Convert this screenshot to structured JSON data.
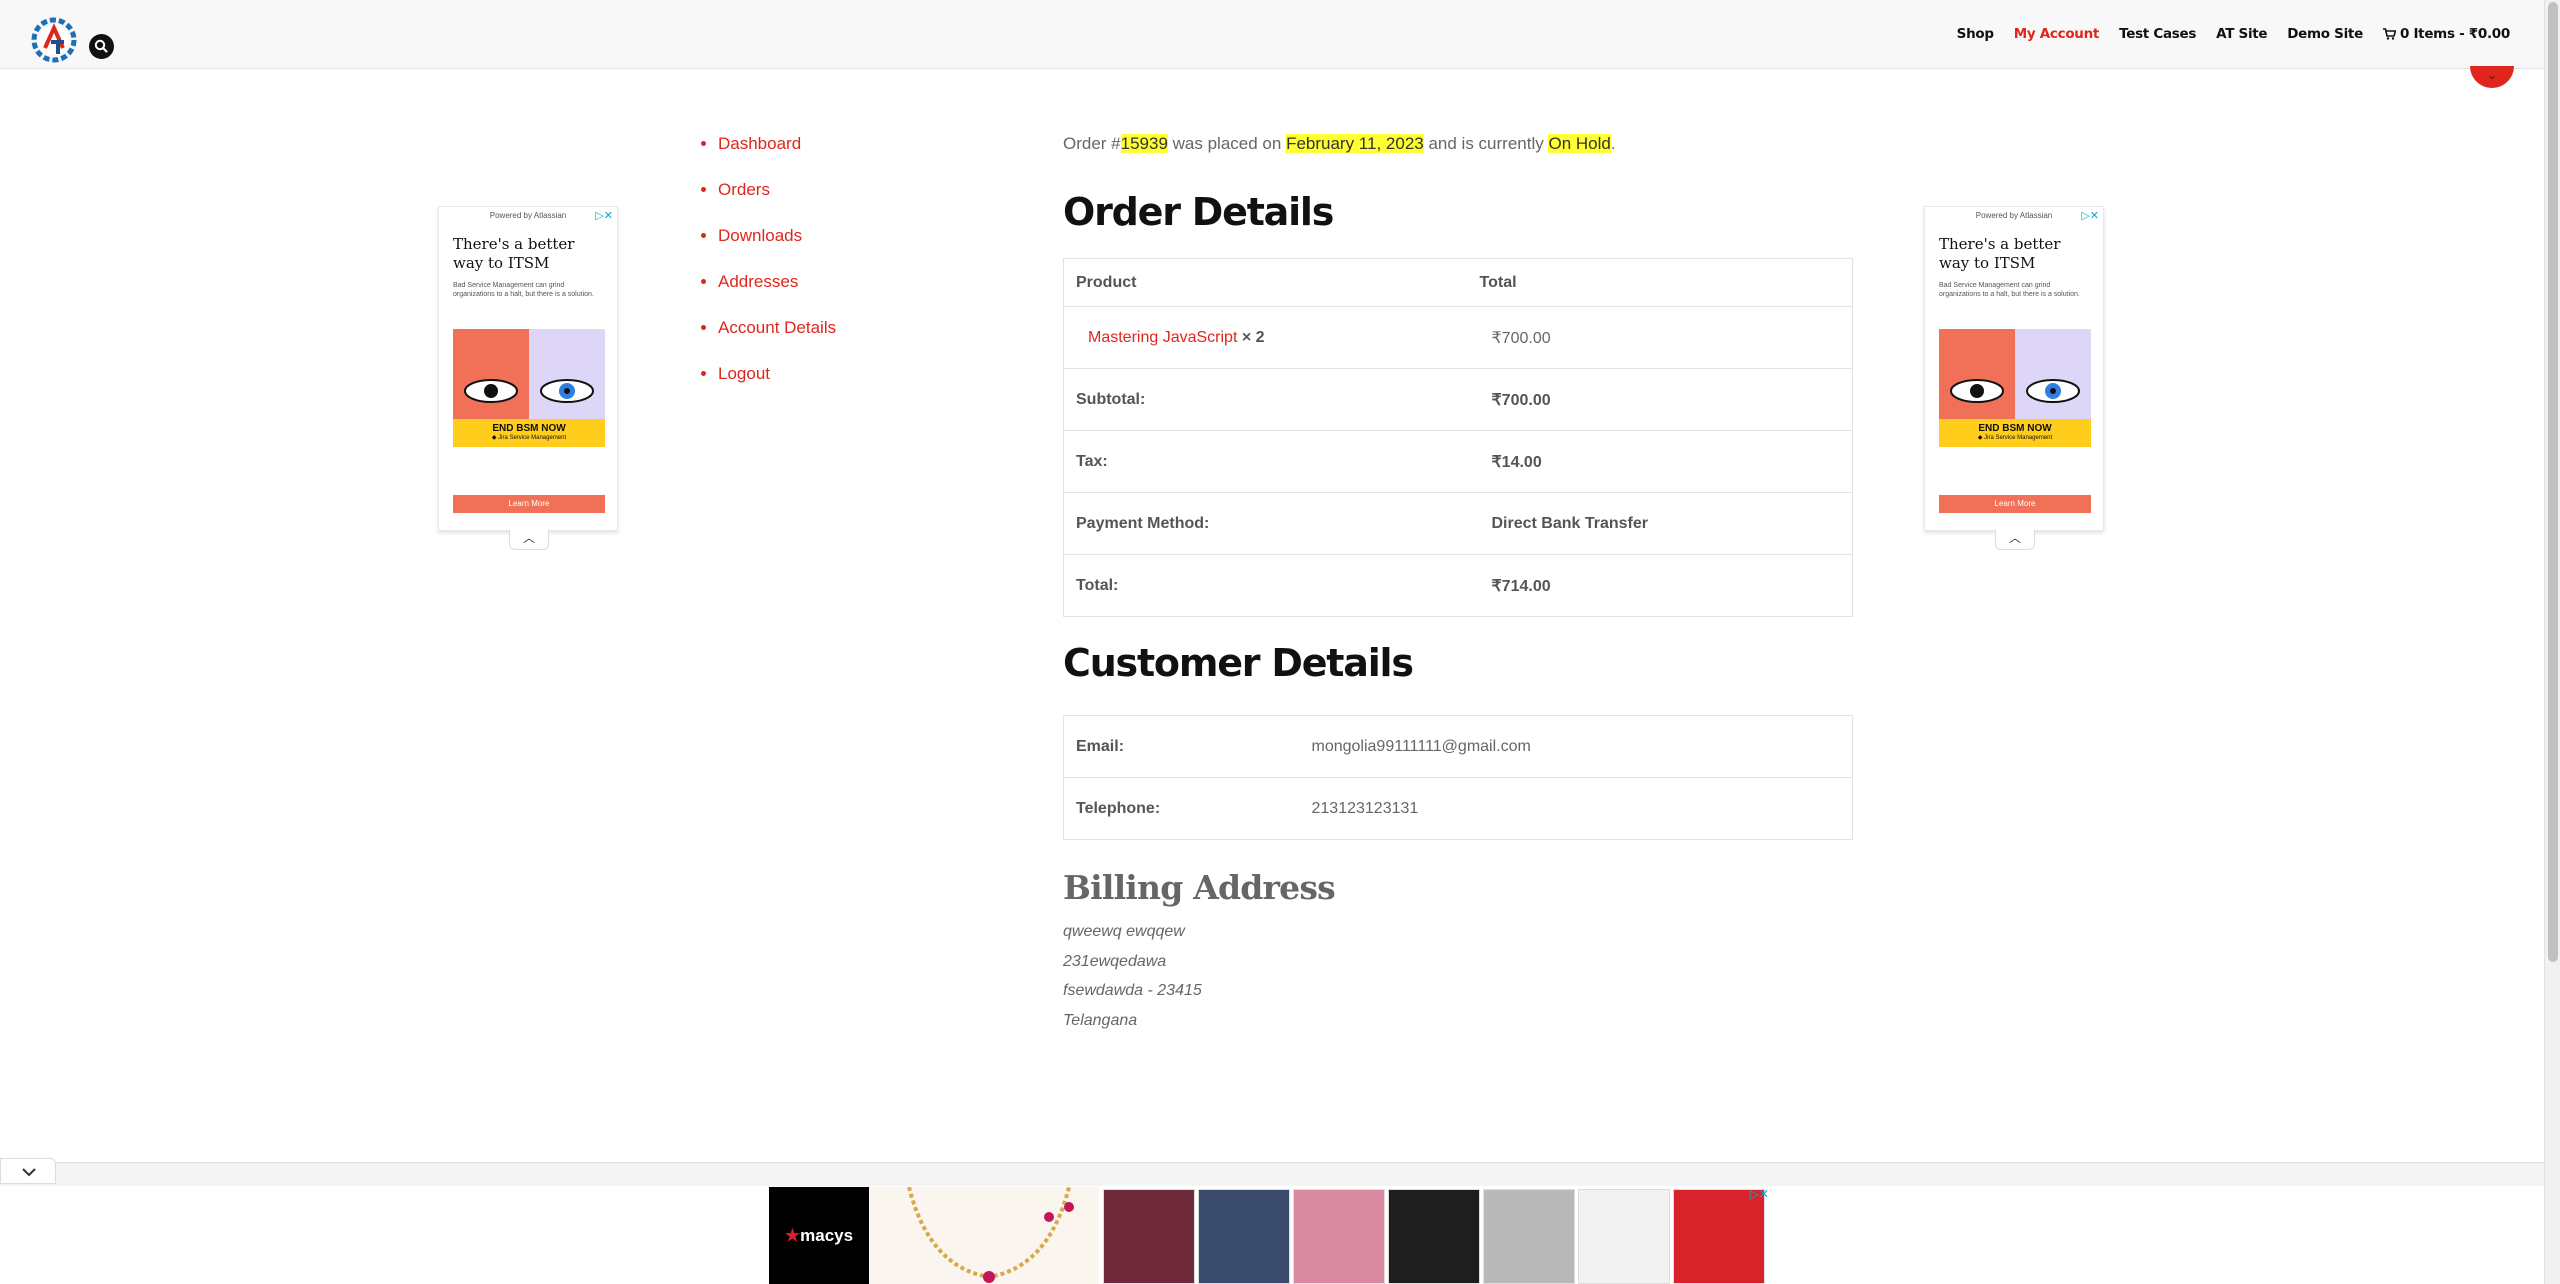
{
  "header": {
    "nav": [
      {
        "label": "Shop",
        "active": false
      },
      {
        "label": "My Account",
        "active": true
      },
      {
        "label": "Test Cases",
        "active": false
      },
      {
        "label": "AT Site",
        "active": false
      },
      {
        "label": "Demo Site",
        "active": false
      }
    ],
    "cart": {
      "icon": "cart-icon",
      "label": "0 Items - ₹0.00"
    }
  },
  "account_nav": [
    "Dashboard",
    "Orders",
    "Downloads",
    "Addresses",
    "Account Details",
    "Logout"
  ],
  "order_notice": {
    "prefix": "Order #",
    "order_number": "15939",
    "mid1": " was placed on ",
    "date": "February 11, 2023",
    "mid2": " and is currently ",
    "status": "On Hold",
    "suffix": "."
  },
  "order_details": {
    "heading": "Order Details",
    "headers": {
      "product": "Product",
      "total": "Total"
    },
    "item": {
      "name": "Mastering JavaScript",
      "qty": "× 2",
      "total": "₹700.00"
    },
    "rows": [
      {
        "label": "Subtotal:",
        "value": "₹700.00"
      },
      {
        "label": "Tax:",
        "value": "₹14.00"
      },
      {
        "label": "Payment Method:",
        "value": "Direct Bank Transfer"
      },
      {
        "label": "Total:",
        "value": "₹714.00"
      }
    ]
  },
  "customer_details": {
    "heading": "Customer Details",
    "rows": [
      {
        "label": "Email:",
        "value": "mongolia99111111@gmail.com"
      },
      {
        "label": "Telephone:",
        "value": "213123123131"
      }
    ]
  },
  "billing_address": {
    "heading": "Billing Address",
    "lines": [
      "qweewq ewqqew",
      "231ewqedawa",
      "fsewdawda - 23415",
      "Telangana"
    ]
  },
  "side_ad": {
    "powered": "Powered by Atlassian",
    "title": "There's a better way to ITSM",
    "body": "Bad Service Management can grind organizations to a halt, but there is a solution.",
    "banner_line1": "END BSM NOW",
    "banner_line2": "◆ Jira Service Management",
    "cta": "Learn More"
  },
  "bottom_ad": {
    "brand": "macys"
  },
  "colors": {
    "accent": "#e0261c",
    "highlight": "#ffff33",
    "heading": "#111111"
  }
}
